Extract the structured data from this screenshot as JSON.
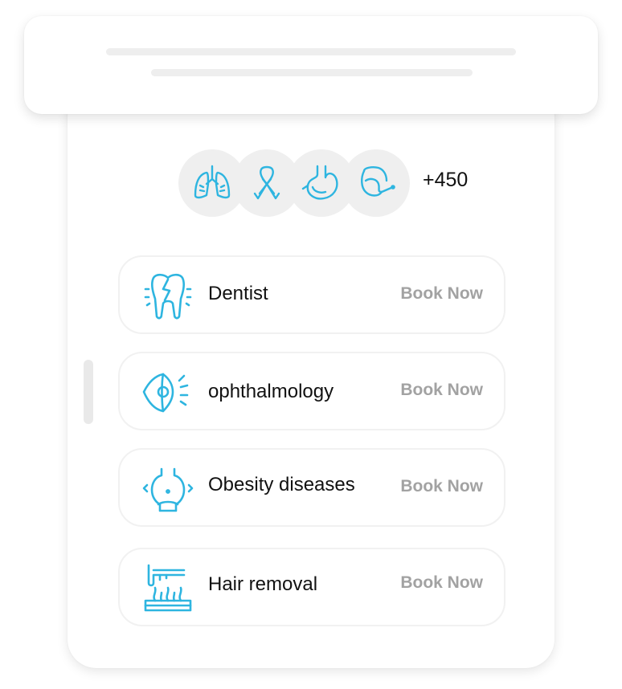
{
  "specialties": {
    "icons": [
      "lungs-icon",
      "cancer-ribbon-icon",
      "stomach-icon",
      "throat-tube-icon"
    ],
    "more_count": "+450"
  },
  "services": [
    {
      "name": "Dentist",
      "icon": "tooth-icon",
      "action_label": "Book Now"
    },
    {
      "name": "ophthalmology",
      "icon": "eye-icon",
      "action_label": "Book Now"
    },
    {
      "name": "Obesity diseases",
      "icon": "belly-icon",
      "action_label": "Book Now"
    },
    {
      "name": "Hair removal",
      "icon": "laser-hair-icon",
      "action_label": "Book Now"
    }
  ],
  "colors": {
    "accent": "#2eb5e0",
    "action_text": "#a2a2a2",
    "circle_bg": "#efefef"
  }
}
